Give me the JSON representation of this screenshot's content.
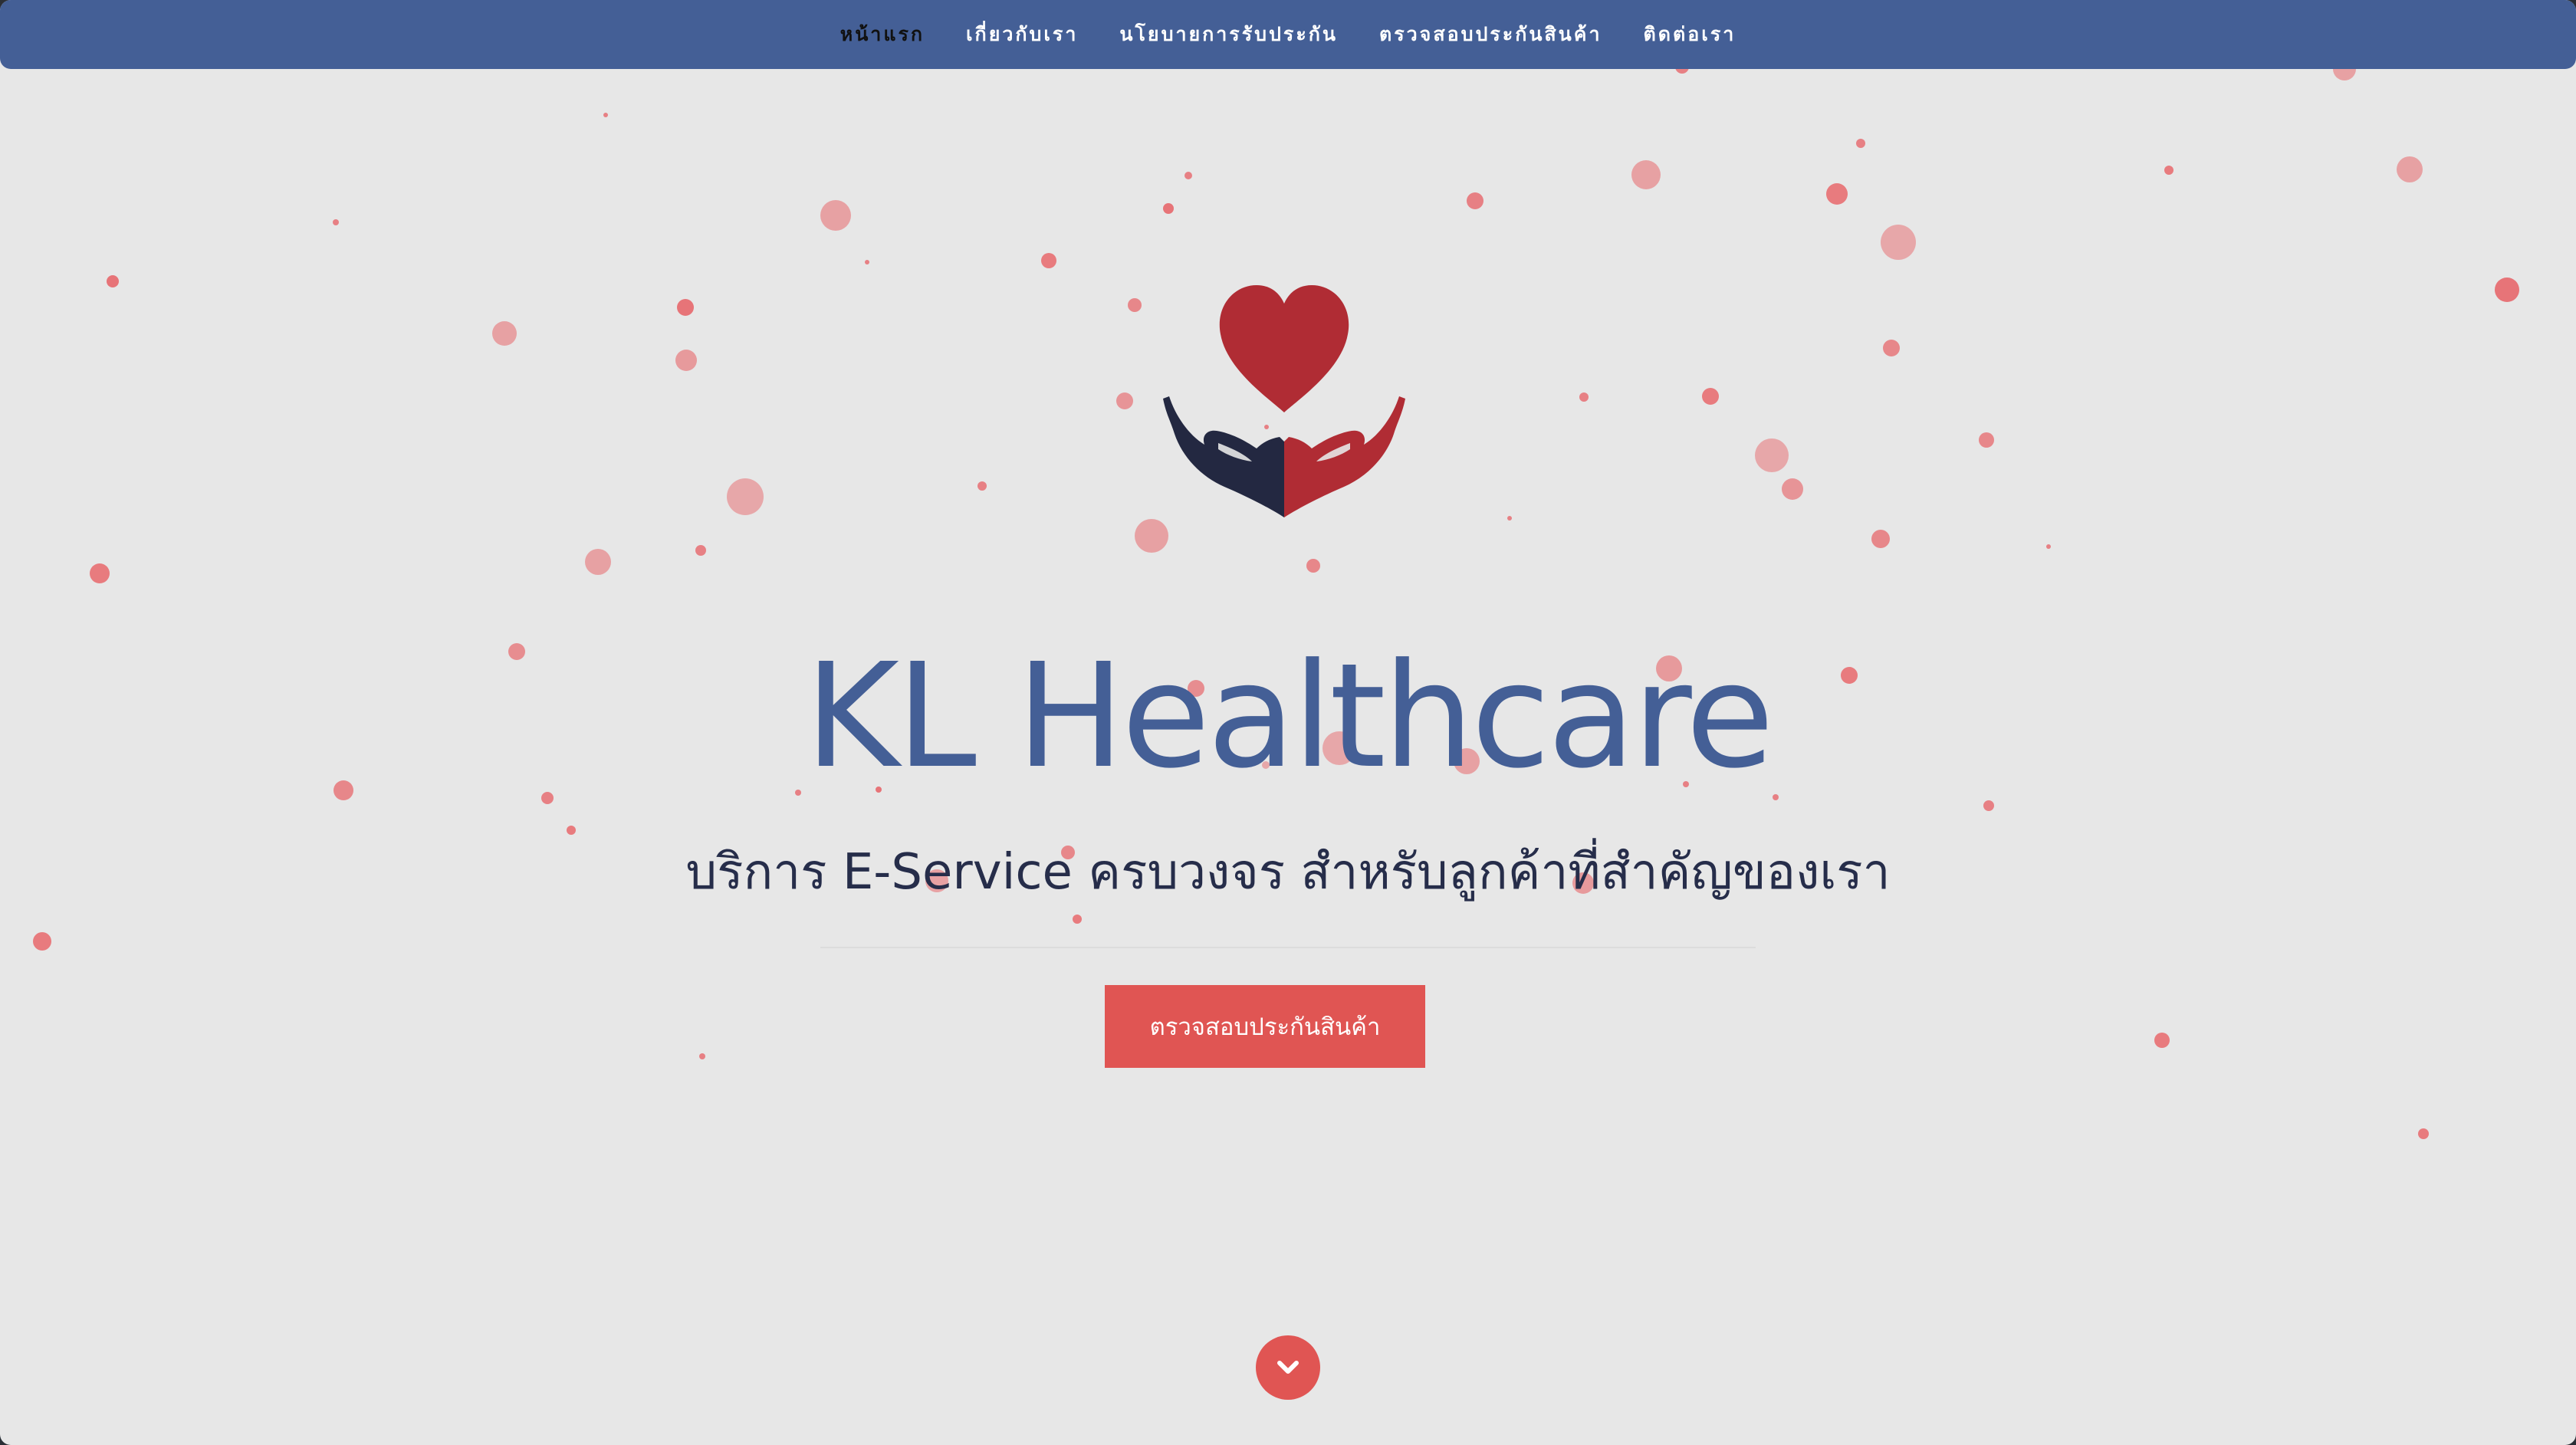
{
  "nav": {
    "items": [
      {
        "label": "หน้าแรก",
        "active": true
      },
      {
        "label": "เกี่ยวกับเรา",
        "active": false
      },
      {
        "label": "นโยบายการรับประกัน",
        "active": false
      },
      {
        "label": "ตรวจสอบประกันสินค้า",
        "active": false
      },
      {
        "label": "ติดต่อเรา",
        "active": false
      }
    ]
  },
  "hero": {
    "logo_icon": "heart-in-hands-icon",
    "title": "KL Healthcare",
    "subtitle": "บริการ E-Service ครบวงจร สำหรับลูกค้าที่สำคัญของเรา",
    "cta_label": "ตรวจสอบประกันสินค้า",
    "scroll_icon": "chevron-down-icon"
  },
  "colors": {
    "nav_background": "#445f96",
    "page_background": "#e7e7e7",
    "title": "#445f96",
    "subtitle": "#262d4a",
    "accent": "#e05553",
    "particle": "#e7676b",
    "heart": "#b02c34",
    "hand_left": "#232841"
  }
}
